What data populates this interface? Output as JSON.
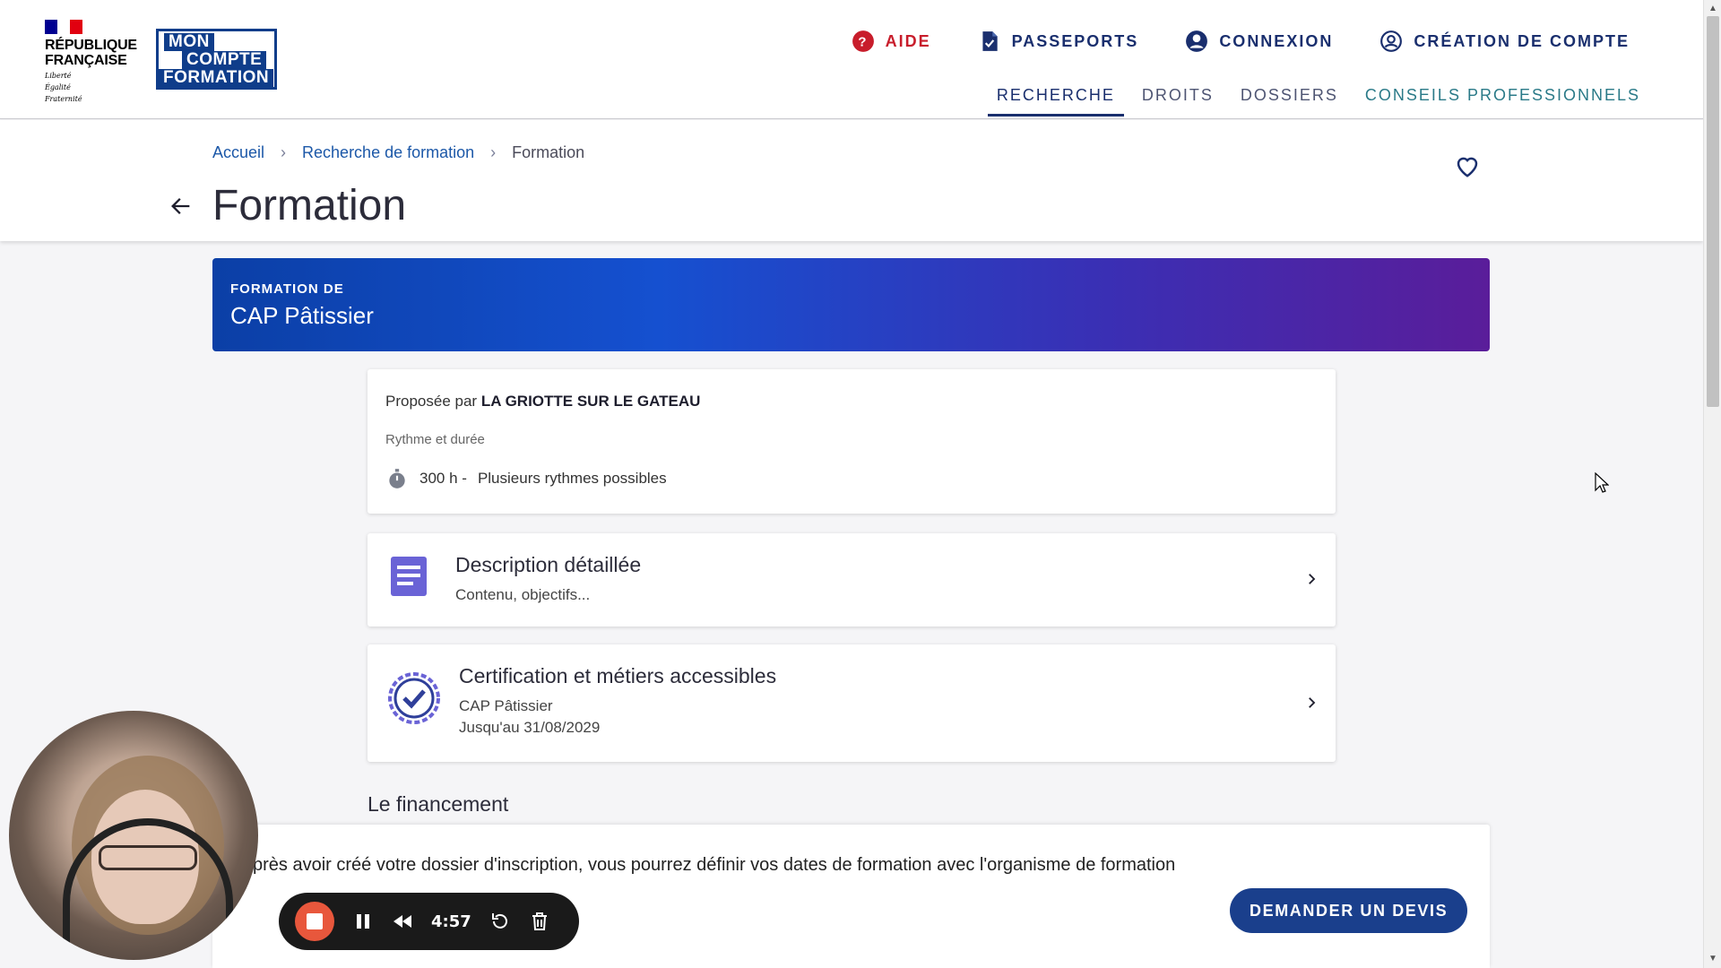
{
  "header": {
    "rf": {
      "title_line1": "RÉPUBLIQUE",
      "title_line2": "FRANÇAISE",
      "motto1": "Liberté",
      "motto2": "Égalité",
      "motto3": "Fraternité"
    },
    "mcf": {
      "line1": "MON",
      "line2": "COMPTE",
      "line3": "FORMATION"
    },
    "top_links": {
      "aide": "AIDE",
      "passeports": "PASSEPORTS",
      "connexion": "CONNEXION",
      "creation": "CRÉATION DE COMPTE"
    },
    "main_nav": {
      "recherche": "RECHERCHE",
      "droits": "DROITS",
      "dossiers": "DOSSIERS",
      "conseils": "CONSEILS PROFESSIONNELS"
    }
  },
  "breadcrumb": {
    "home": "Accueil",
    "search": "Recherche de formation",
    "current": "Formation"
  },
  "page_title": "Formation",
  "banner": {
    "kicker": "FORMATION DE",
    "title": "CAP Pâtissier"
  },
  "info_card": {
    "by_prefix": "Proposée par",
    "provider": "LA GRIOTTE SUR LE GATEAU",
    "rhythm_label": "Rythme et durée",
    "duration": "300 h -",
    "rhythm": "Plusieurs rythmes possibles"
  },
  "description_card": {
    "title": "Description détaillée",
    "subtitle": "Contenu, objectifs..."
  },
  "certification_card": {
    "title": "Certification et métiers accessibles",
    "line1": "CAP Pâtissier",
    "line2": "Jusqu'au 31/08/2029"
  },
  "financing": {
    "title": "Le financement",
    "text": "près avoir créé votre dossier d'inscription, vous pourrez définir vos dates de formation avec l'organisme de formation",
    "button": "DEMANDER UN DEVIS"
  },
  "recorder": {
    "time": "4:57"
  },
  "colors": {
    "brand_blue": "#1a2f6e",
    "aide_red": "#c81d2b",
    "link_blue": "#1c58a8",
    "teal": "#2a7a88",
    "button_blue": "#1a3f8c",
    "record_orange": "#e8573c"
  },
  "icons": {
    "aide": "question-circle-icon",
    "passeports": "document-check-icon",
    "connexion": "user-circle-icon",
    "creation": "user-outline-icon",
    "favorite": "heart-icon",
    "back": "arrow-left-icon",
    "duration": "stopwatch-icon",
    "description": "document-lines-icon",
    "certification": "badge-check-icon",
    "chevron": "chevron-right-icon"
  }
}
